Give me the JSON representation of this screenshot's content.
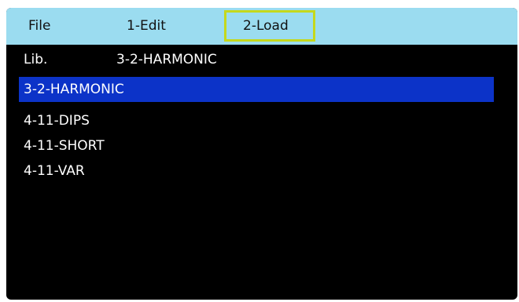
{
  "menu": {
    "file_label": "File",
    "edit_label": "1-Edit",
    "load_label": "2-Load"
  },
  "library": {
    "label": "Lib.",
    "value": "3-2-HARMONIC"
  },
  "list": {
    "items": [
      {
        "label": "3-2-HARMONIC",
        "selected": true
      },
      {
        "label": "4-11-DIPS",
        "selected": false
      },
      {
        "label": "4-11-SHORT",
        "selected": false
      },
      {
        "label": "4-11-VAR",
        "selected": false
      }
    ]
  },
  "colors": {
    "menubar": "#9bdcf0",
    "focus_outline": "#c5d81c",
    "selection": "#0c33c8",
    "screen": "#000000"
  }
}
